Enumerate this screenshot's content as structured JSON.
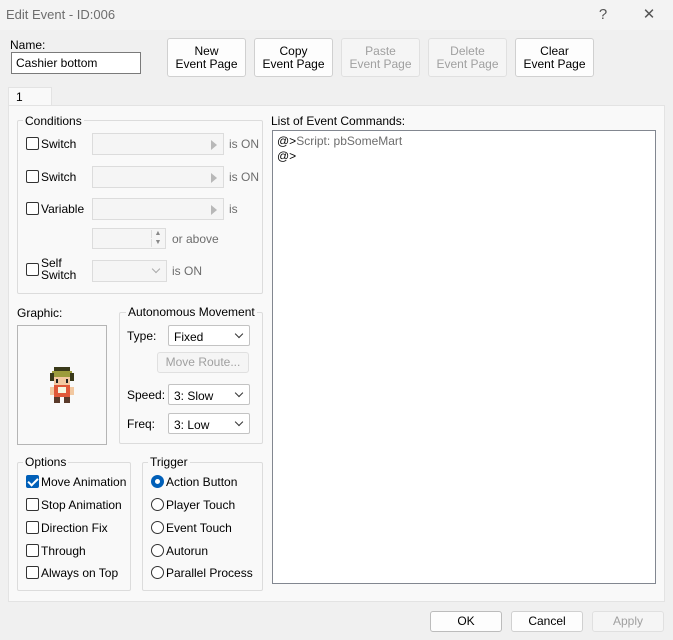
{
  "window": {
    "title": "Edit Event - ID:006",
    "help": "?",
    "close": "✕"
  },
  "name_field": {
    "label": "Name:",
    "value": "Cashier bottom"
  },
  "toolbar": {
    "new": [
      "New",
      "Event Page"
    ],
    "copy": [
      "Copy",
      "Event Page"
    ],
    "paste": [
      "Paste",
      "Event Page"
    ],
    "delete": [
      "Delete",
      "Event Page"
    ],
    "clear": [
      "Clear",
      "Event Page"
    ]
  },
  "tab": {
    "label": "1"
  },
  "conditions": {
    "title": "Conditions",
    "switch1": {
      "label": "Switch",
      "suffix": "is ON"
    },
    "switch2": {
      "label": "Switch",
      "suffix": "is ON"
    },
    "variable": {
      "label": "Variable",
      "suffix": "is",
      "above": "or above"
    },
    "self_switch": {
      "label_line1": "Self",
      "label_line2": "Switch",
      "suffix": "is ON"
    }
  },
  "graphic": {
    "label": "Graphic:"
  },
  "movement": {
    "title": "Autonomous Movement",
    "type_label": "Type:",
    "type_value": "Fixed",
    "move_route": "Move Route...",
    "speed_label": "Speed:",
    "speed_value": "3: Slow",
    "freq_label": "Freq:",
    "freq_value": "3: Low"
  },
  "options": {
    "title": "Options",
    "items": [
      {
        "label": "Move Animation",
        "checked": true
      },
      {
        "label": "Stop Animation",
        "checked": false
      },
      {
        "label": "Direction Fix",
        "checked": false
      },
      {
        "label": "Through",
        "checked": false
      },
      {
        "label": "Always on Top",
        "checked": false
      }
    ]
  },
  "trigger": {
    "title": "Trigger",
    "items": [
      {
        "label": "Action Button",
        "selected": true
      },
      {
        "label": "Player Touch",
        "selected": false
      },
      {
        "label": "Event Touch",
        "selected": false
      },
      {
        "label": "Autorun",
        "selected": false
      },
      {
        "label": "Parallel Process",
        "selected": false
      }
    ]
  },
  "commands": {
    "label": "List of Event Commands:",
    "lines": [
      {
        "prefix": "@>",
        "text": "Script: pbSomeMart"
      },
      {
        "prefix": "@>",
        "text": ""
      }
    ]
  },
  "footer": {
    "ok": "OK",
    "cancel": "Cancel",
    "apply": "Apply"
  },
  "colors": {
    "accent": "#005fb8",
    "disabled_text": "#a0a0a0"
  }
}
